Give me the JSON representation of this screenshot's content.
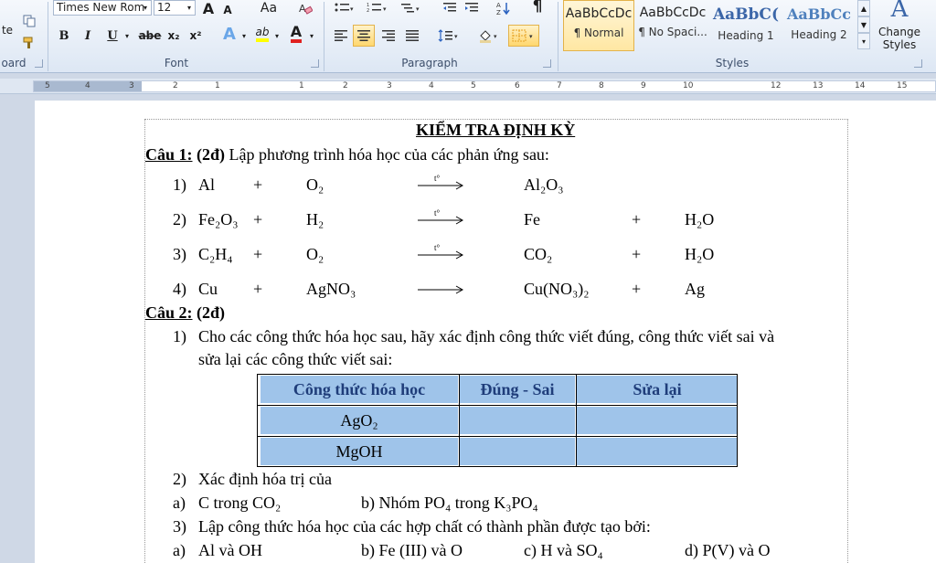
{
  "ribbon": {
    "clipboard": {
      "label": "oard",
      "paste_fragment": "te"
    },
    "font": {
      "label": "Font",
      "font_name": "Times New Rom",
      "font_size": "12",
      "grow": "A",
      "shrink": "A",
      "change_case": "Aa",
      "bold": "B",
      "italic": "I",
      "underline": "U",
      "strikethrough": "abe",
      "subscript": "x₂",
      "superscript": "x²",
      "text_effects": "A",
      "highlight": "ab",
      "font_color": "A",
      "highlight_color": "#ffff00",
      "font_color_value": "#e02020"
    },
    "paragraph": {
      "label": "Paragraph"
    },
    "styles": {
      "label": "Styles",
      "tiles": [
        {
          "sample": "AaBbCcDc",
          "name": "¶ Normal",
          "selected": true
        },
        {
          "sample": "AaBbCcDc",
          "name": "¶ No Spaci...",
          "selected": false
        },
        {
          "sample": "AaBbC(",
          "name": "Heading 1",
          "selected": false
        },
        {
          "sample": "AaBbCc",
          "name": "Heading 2",
          "selected": false
        }
      ],
      "change_styles": "Change Styles"
    }
  },
  "ruler": {
    "ticks": [
      "5",
      "4",
      "3",
      "2",
      "1",
      "1",
      "2",
      "3",
      "4",
      "5",
      "6",
      "7",
      "8",
      "9",
      "10",
      "12",
      "13",
      "14",
      "15"
    ]
  },
  "document": {
    "title": "KIỂM TRA ĐỊNH KỲ",
    "q1": {
      "head": "Câu 1:",
      "points": "(2đ)",
      "text": "Lập phương trình hóa học của các phản ứng sau:",
      "arrow_label": "t°",
      "reactions": [
        {
          "num": "1)",
          "r1": "Al",
          "plus1": "+",
          "r2": "O₂",
          "p1": "Al₂O₃",
          "plus2": "",
          "p2": "",
          "heated": true
        },
        {
          "num": "2)",
          "r1": "Fe₂O₃",
          "plus1": "+",
          "r2": "H₂",
          "p1": "Fe",
          "plus2": "+",
          "p2": "H₂O",
          "heated": true
        },
        {
          "num": "3)",
          "r1": "C₂H₄",
          "plus1": "+",
          "r2": "O₂",
          "p1": "CO₂",
          "plus2": "+",
          "p2": "H₂O",
          "heated": true
        },
        {
          "num": "4)",
          "r1": "Cu",
          "plus1": "+",
          "r2": "AgNO₃",
          "p1": "Cu(NO₃)₂",
          "plus2": "+",
          "p2": "Ag",
          "heated": false
        }
      ]
    },
    "q2": {
      "head": "Câu 2:",
      "points": "(2đ)",
      "item1_num": "1)",
      "item1_line1": "Cho các công thức hóa học sau, hãy xác định công thức viết đúng, công thức viết sai và",
      "item1_line2": "sửa lại các công thức viết sai:",
      "table": {
        "headers": [
          "Công thức hóa học",
          "Đúng - Sai",
          "Sửa lại"
        ],
        "rows": [
          [
            "AgO₂",
            "",
            ""
          ],
          [
            "MgOH",
            "",
            ""
          ]
        ]
      },
      "item2_num": "2)",
      "item2": "Xác định hóa trị của",
      "item2_a_label": "a)",
      "item2_a": "C trong CO₂",
      "item2_b": "b) Nhóm PO₄ trong K₃PO₄",
      "item3_num": "3)",
      "item3": "Lập công thức hóa học của các hợp chất có thành phần được tạo bởi:",
      "item3_a_label": "a)",
      "item3_a": "Al và OH",
      "item3_b": "b) Fe (III) và O",
      "item3_c": "c) H và SO₄",
      "item3_d": "d) P(V) và O"
    }
  }
}
